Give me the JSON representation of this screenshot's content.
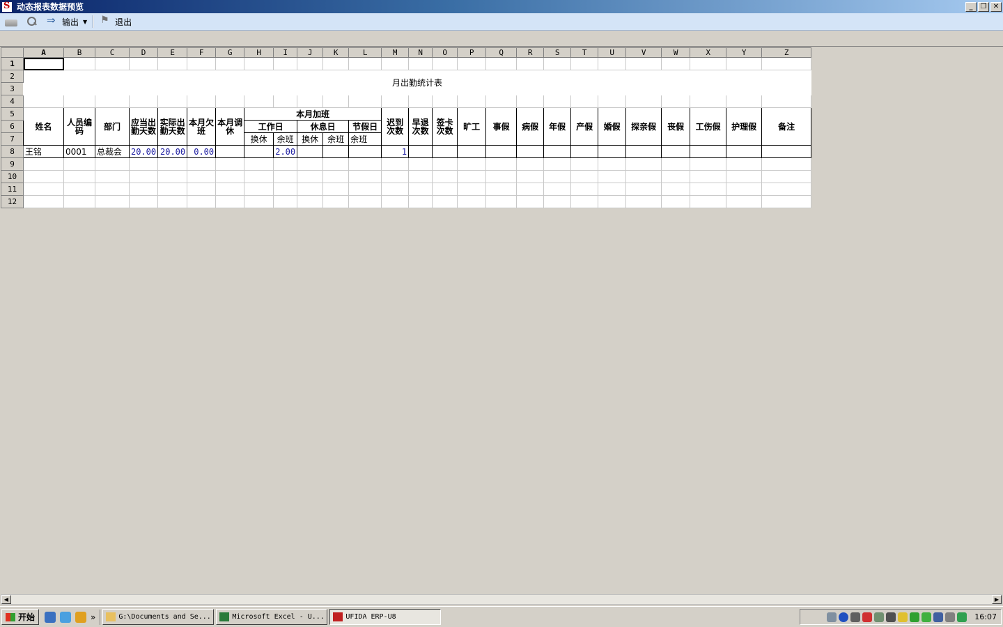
{
  "window": {
    "title": "动态报表数据预览",
    "minimize": "_",
    "restore": "❐",
    "close": "✕"
  },
  "toolbar": {
    "export_label": "输出",
    "exit_label": "退出"
  },
  "sheet": {
    "columns": [
      "A",
      "B",
      "C",
      "D",
      "E",
      "F",
      "G",
      "H",
      "I",
      "J",
      "K",
      "L",
      "M",
      "N",
      "O",
      "P",
      "Q",
      "R",
      "S",
      "T",
      "U",
      "V",
      "W",
      "X",
      "Y",
      "Z"
    ],
    "rows": [
      "1",
      "2",
      "3",
      "4",
      "5",
      "6",
      "7",
      "8",
      "9",
      "10",
      "11",
      "12"
    ],
    "title": "月出勤统计表",
    "headers": {
      "name": "姓名",
      "emp_code": "人员编码",
      "dept": "部门",
      "due_days": "应当出勤天数",
      "actual_days": "实际出勤天数",
      "owed": "本月欠班",
      "adjust": "本月调休",
      "overtime": "本月加班",
      "workday": "工作日",
      "restday": "休息日",
      "holiday": "节假日",
      "swap_rest": "换休",
      "extra": "余班",
      "late": "迟到次数",
      "early": "早退次数",
      "sign": "签卡次数",
      "absent": "旷工",
      "personal": "事假",
      "sick": "病假",
      "annual": "年假",
      "maternity": "产假",
      "marriage": "婚假",
      "family": "探亲假",
      "funeral": "丧假",
      "injury": "工伤假",
      "nursing": "护理假",
      "remark": "备注"
    },
    "record": {
      "name": "王铭",
      "emp_code": "0001",
      "dept": "总裁会",
      "due_days": "20.00",
      "actual_days": "20.00",
      "owed": "0.00",
      "workday_extra": "2.00",
      "late": "1"
    }
  },
  "taskbar": {
    "start": "开始",
    "tasks": [
      {
        "label": "G:\\Documents and Se..."
      },
      {
        "label": "Microsoft Excel - U..."
      },
      {
        "label": "UFIDA ERP-U8"
      }
    ],
    "more": "»",
    "clock": "16:07"
  },
  "colors": {
    "title_bar_start": "#0a246a",
    "toolbar_bg": "#d4e4f7",
    "number_text": "#1a1aa0"
  }
}
